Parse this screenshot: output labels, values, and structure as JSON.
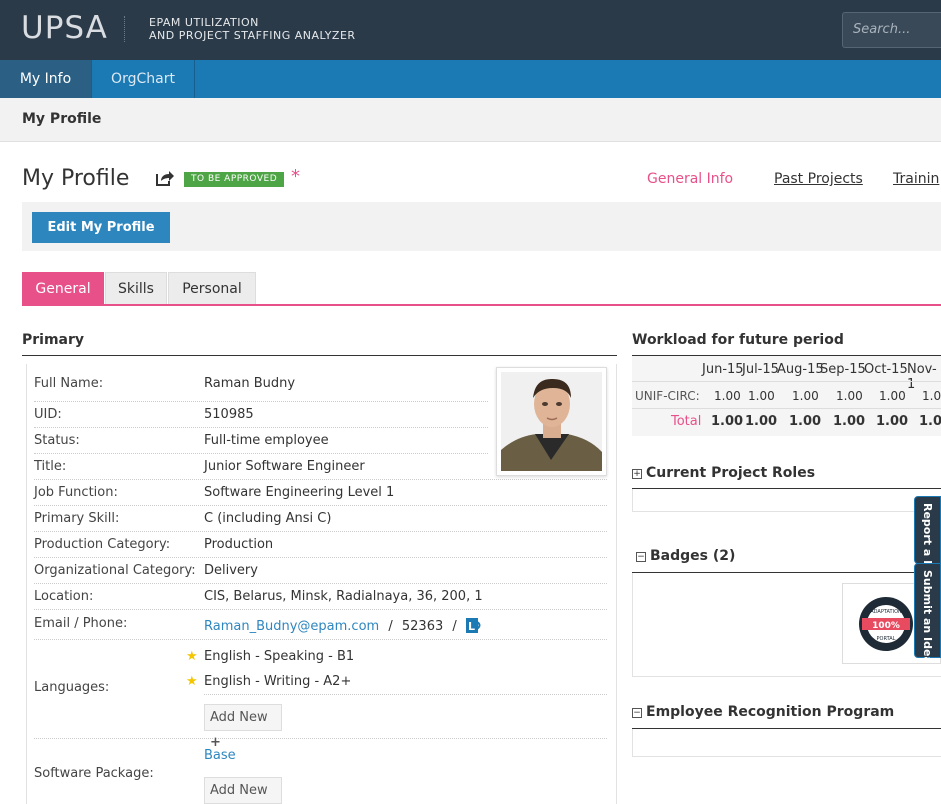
{
  "header": {
    "logo": "UPSA",
    "subtitle_line1": "EPAM UTILIZATION",
    "subtitle_line2": "AND PROJECT STAFFING ANALYZER",
    "search_placeholder": "Search..."
  },
  "nav": {
    "tabs": [
      {
        "label": "My Info",
        "active": true
      },
      {
        "label": "OrgChart",
        "active": false
      }
    ]
  },
  "subbar": {
    "title": "My Profile"
  },
  "profile": {
    "title": "My Profile",
    "status_badge": "TO BE APPROVED",
    "asterisk": "*",
    "tabs": [
      "General Info",
      "Past Projects",
      "Trainin"
    ],
    "edit_button": "Edit My Profile",
    "subtabs": [
      "General",
      "Skills",
      "Personal"
    ]
  },
  "primary": {
    "title": "Primary",
    "fields": [
      {
        "label": "Full Name:",
        "value": "Raman Budny"
      },
      {
        "label": "UID:",
        "value": "510985"
      },
      {
        "label": "Status:",
        "value": "Full-time employee"
      },
      {
        "label": "Title:",
        "value": "Junior Software Engineer"
      },
      {
        "label": "Job Function:",
        "value": "Software Engineering Level 1"
      },
      {
        "label": "Primary Skill:",
        "value": "C (including Ansi C)"
      },
      {
        "label": "Production Category:",
        "value": "Production"
      },
      {
        "label": "Organizational Category:",
        "value": "Delivery"
      },
      {
        "label": "Location:",
        "value": "CIS, Belarus, Minsk, Radialnaya, 36, 200, 1"
      }
    ],
    "contact": {
      "label": "Email / Phone:",
      "email": "Raman_Budny@epam.com",
      "sep": "/",
      "phone": "52363",
      "sep2": "/"
    },
    "languages": {
      "label": "Languages:",
      "items": [
        "English - Speaking - B1",
        "English - Writing - A2+"
      ],
      "add": "Add New"
    },
    "software": {
      "label": "Software Package:",
      "value": "Base",
      "add": "Add New"
    }
  },
  "workload": {
    "title": "Workload for future period",
    "months": [
      "Jun-15",
      "Jul-15",
      "Aug-15",
      "Sep-15",
      "Oct-15",
      "Nov-1"
    ],
    "rows": [
      {
        "name": "UNIF-CIRC:",
        "values": [
          "1.00",
          "1.00",
          "1.00",
          "1.00",
          "1.00",
          "1.0"
        ]
      },
      {
        "name": "Total",
        "values": [
          "1.00",
          "1.00",
          "1.00",
          "1.00",
          "1.00",
          "1.0"
        ]
      }
    ]
  },
  "right": {
    "roles_title": "Current Project Roles",
    "badges_title": "Badges (2)",
    "erp_title": "Employee Recognition Program",
    "badge_text_top": "ADAPTATION",
    "badge_text_mid": "100%",
    "badge_text_bottom": "PORTAL"
  },
  "side_tabs": {
    "report": "Report a B",
    "idea": "Submit an Idea"
  },
  "colors": {
    "header": "#2b3a48",
    "nav": "#1b79b4",
    "accent": "#e8508a",
    "badge_green": "#4ea545",
    "button": "#2e86bf"
  }
}
